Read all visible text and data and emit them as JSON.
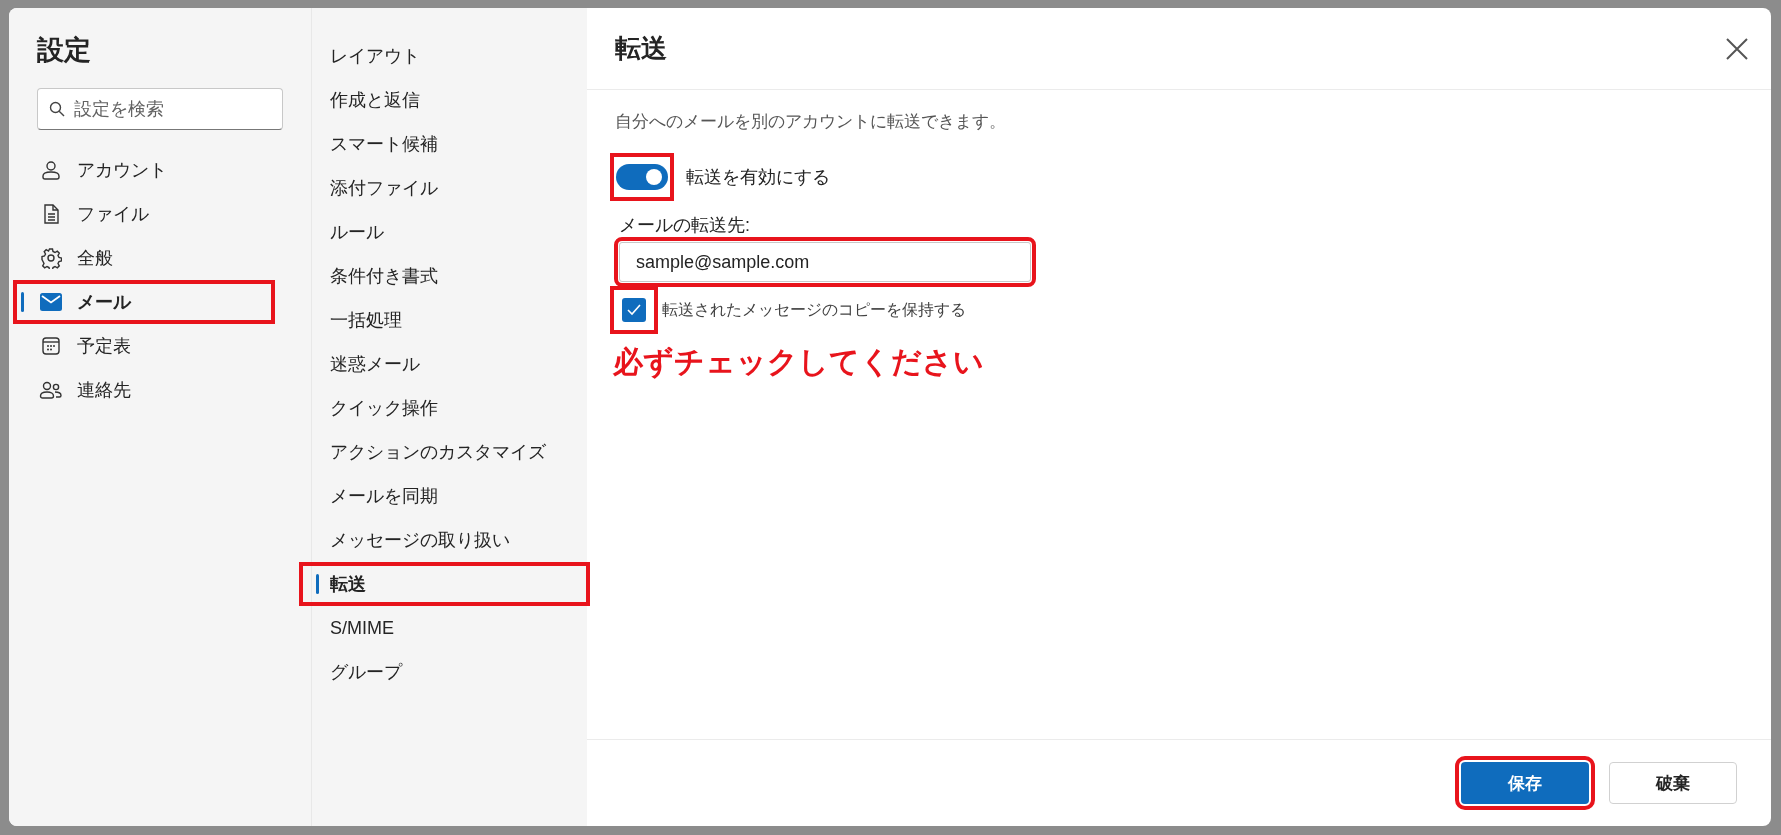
{
  "dialog": {
    "title": "設定",
    "search": {
      "placeholder": "設定を検索"
    },
    "categories": [
      {
        "label": "アカウント",
        "kind": "person",
        "selected": false,
        "highlighted": false
      },
      {
        "label": "ファイル",
        "kind": "file",
        "selected": false,
        "highlighted": false
      },
      {
        "label": "全般",
        "kind": "gear",
        "selected": false,
        "highlighted": false
      },
      {
        "label": "メール",
        "kind": "mail",
        "selected": true,
        "highlighted": true
      },
      {
        "label": "予定表",
        "kind": "calendar",
        "selected": false,
        "highlighted": false
      },
      {
        "label": "連絡先",
        "kind": "people",
        "selected": false,
        "highlighted": false
      }
    ],
    "subcategories": [
      {
        "label": "レイアウト",
        "selected": false,
        "highlighted": false
      },
      {
        "label": "作成と返信",
        "selected": false,
        "highlighted": false
      },
      {
        "label": "スマート候補",
        "selected": false,
        "highlighted": false
      },
      {
        "label": "添付ファイル",
        "selected": false,
        "highlighted": false
      },
      {
        "label": "ルール",
        "selected": false,
        "highlighted": false
      },
      {
        "label": "条件付き書式",
        "selected": false,
        "highlighted": false
      },
      {
        "label": "一括処理",
        "selected": false,
        "highlighted": false
      },
      {
        "label": "迷惑メール",
        "selected": false,
        "highlighted": false
      },
      {
        "label": "クイック操作",
        "selected": false,
        "highlighted": false
      },
      {
        "label": "アクションのカスタマイズ",
        "selected": false,
        "highlighted": false
      },
      {
        "label": "メールを同期",
        "selected": false,
        "highlighted": false
      },
      {
        "label": "メッセージの取り扱い",
        "selected": false,
        "highlighted": false
      },
      {
        "label": "転送",
        "selected": true,
        "highlighted": true
      },
      {
        "label": "S/MIME",
        "selected": false,
        "highlighted": false
      },
      {
        "label": "グループ",
        "selected": false,
        "highlighted": false
      }
    ],
    "panel": {
      "title": "転送",
      "description": "自分へのメールを別のアカウントに転送できます。",
      "toggle": {
        "label": "転送を有効にする",
        "on": true,
        "highlighted": true
      },
      "address": {
        "label": "メールの転送先:",
        "value": "sample@sample.com",
        "highlighted": true
      },
      "keep_copy": {
        "label": "転送されたメッセージのコピーを保持する",
        "checked": true,
        "highlighted": true
      },
      "note": "必ずチェックしてください",
      "buttons": [
        {
          "label": "保存",
          "kind": "primary",
          "highlighted": true
        },
        {
          "label": "破棄",
          "kind": "secondary",
          "highlighted": false
        }
      ]
    }
  }
}
